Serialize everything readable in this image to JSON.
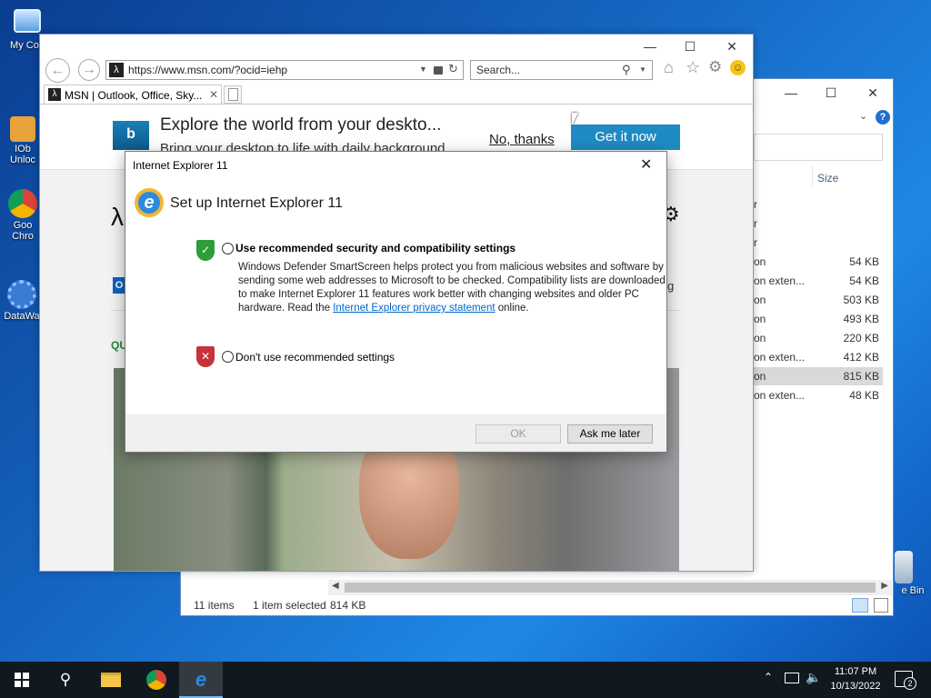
{
  "desktop": {
    "icons": [
      {
        "label": "My Con"
      },
      {
        "label": "IOb Unloc"
      },
      {
        "label": "Goo Chro"
      },
      {
        "label": "DataWa"
      },
      {
        "label": "e Bin"
      }
    ]
  },
  "explorer": {
    "column_size": "Size",
    "rows": [
      {
        "type": "r",
        "size": ""
      },
      {
        "type": "r",
        "size": ""
      },
      {
        "type": "r",
        "size": ""
      },
      {
        "type": "on",
        "size": "54 KB"
      },
      {
        "type": "on exten...",
        "size": "54 KB"
      },
      {
        "type": "on",
        "size": "503 KB"
      },
      {
        "type": "on",
        "size": "493 KB"
      },
      {
        "type": "on",
        "size": "220 KB"
      },
      {
        "type": "on exten...",
        "size": "412 KB"
      },
      {
        "type": "on",
        "size": "815 KB"
      },
      {
        "type": "on exten...",
        "size": "48 KB"
      }
    ],
    "status_items": "11 items",
    "status_selected": "1 item selected",
    "status_size": "814 KB"
  },
  "ie": {
    "url": "https://www.msn.com/?ocid=iehp",
    "search_placeholder": "Search...",
    "tab_title": "MSN | Outlook, Office, Sky...",
    "banner_title": "Explore the world from your deskto...",
    "banner_subtitle": "Bring your desktop to life with daily background",
    "no_thanks": "No, thanks",
    "get_it_now": "Get it now",
    "side_text_g": "g",
    "side_text_qu": "QU"
  },
  "dialog": {
    "window_title": "Internet Explorer 11",
    "heading": "Set up Internet Explorer 11",
    "option1_label": "Use recommended security and compatibility settings",
    "option1_desc_a": "Windows Defender SmartScreen helps protect you from malicious websites and software by sending some web addresses to Microsoft to be checked. Compatibility lists are downloaded to make Internet Explorer 11 features work better with changing websites and older PC hardware. Read the ",
    "option1_link": "Internet Explorer privacy statement",
    "option1_desc_b": " online.",
    "option2_label": "Don't use recommended settings",
    "ok": "OK",
    "ask_later": "Ask me later"
  },
  "taskbar": {
    "time": "11:07 PM",
    "date": "10/13/2022",
    "notifications": "2"
  },
  "colors": {
    "accent": "#1e8bc3",
    "link": "#0066cc"
  }
}
